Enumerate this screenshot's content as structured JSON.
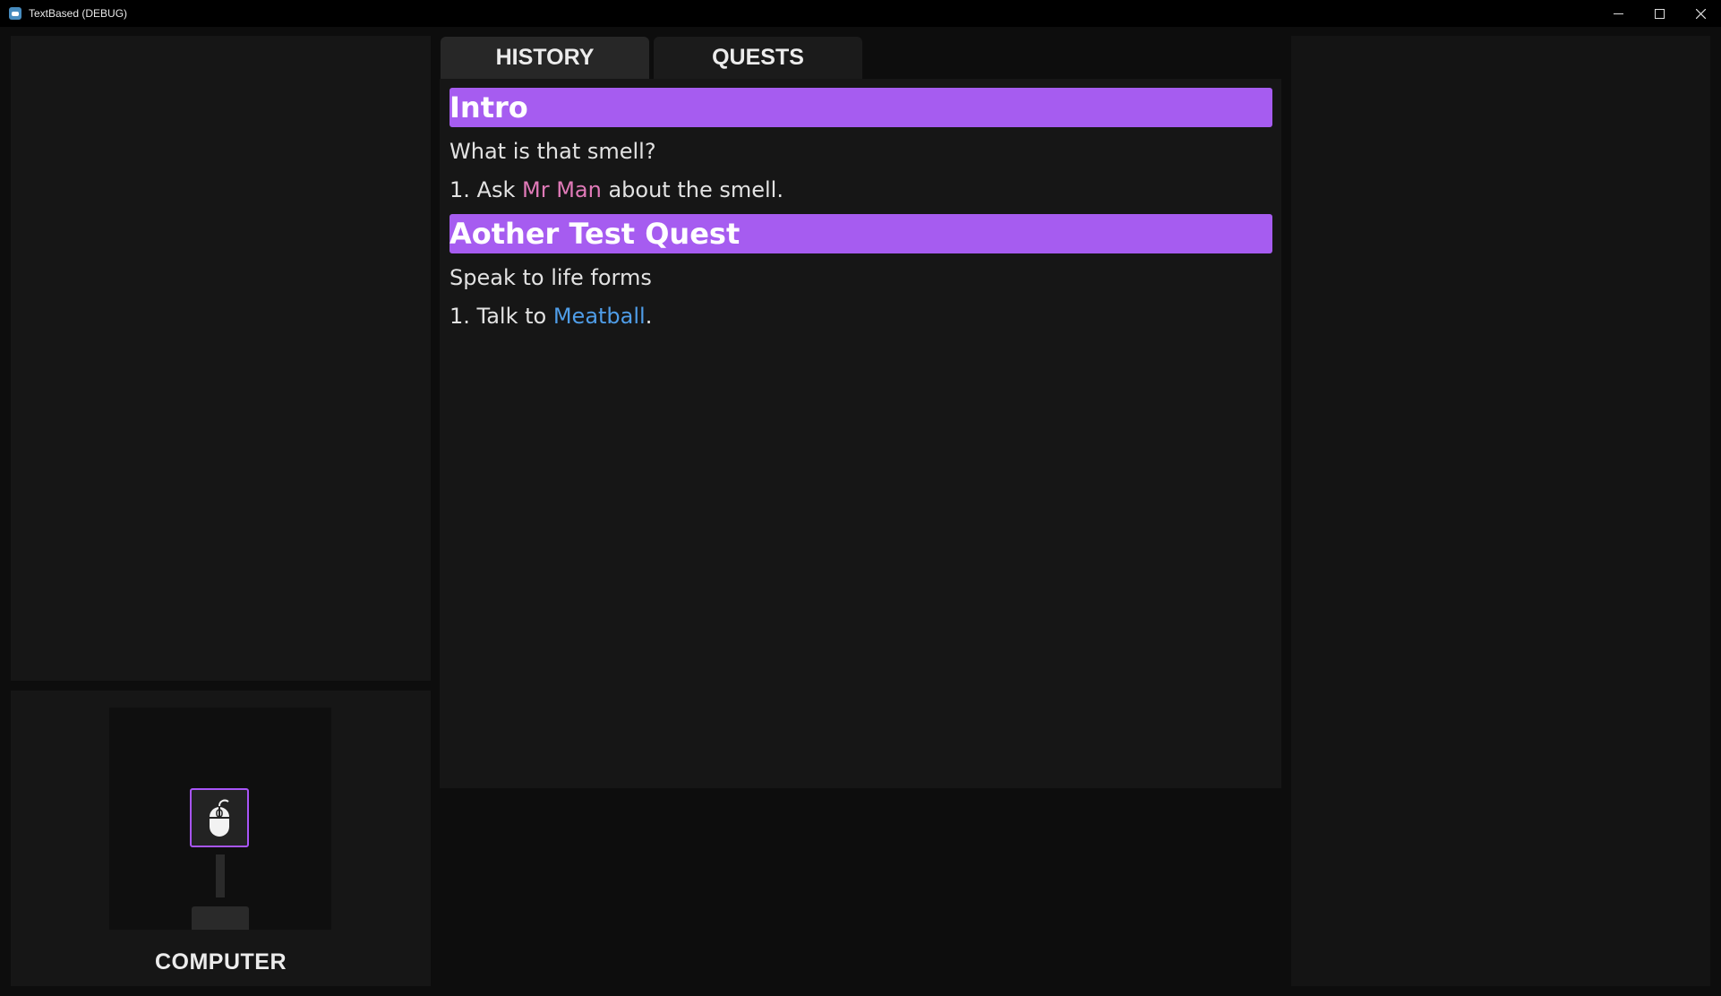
{
  "window": {
    "title": "TextBased (DEBUG)",
    "controls": [
      "minimize-icon",
      "maximize-icon",
      "close-icon"
    ]
  },
  "tabs": [
    {
      "label": "HISTORY"
    },
    {
      "label": "QUESTS"
    }
  ],
  "quests": [
    {
      "title": "Intro",
      "description": "What is that smell?",
      "objective": {
        "prefix": "1. Ask ",
        "npc": "Mr Man",
        "suffix": " about the smell.",
        "npc_color": "#e07ab8"
      }
    },
    {
      "title": "Aother Test Quest",
      "description": "Speak to life forms",
      "objective": {
        "prefix": "1. Talk to ",
        "npc": "Meatball",
        "suffix": ".",
        "npc_color": "#4f9de8"
      }
    }
  ],
  "computer": {
    "label": "COMPUTER",
    "slot_icon": "mouse-icon"
  },
  "colors": {
    "accent": "#a855f7",
    "quest_header": "#a65cf0",
    "background": "#0d0d0d"
  }
}
